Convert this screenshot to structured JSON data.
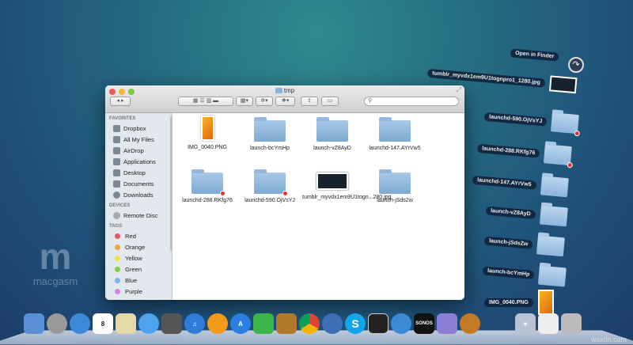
{
  "window": {
    "title": "tmp",
    "search_placeholder": ""
  },
  "sidebar": {
    "favorites_header": "FAVORITES",
    "favorites": [
      "Dropbox",
      "All My Files",
      "AirDrop",
      "Applications",
      "Desktop",
      "Documents",
      "Downloads"
    ],
    "devices_header": "DEVICES",
    "devices": [
      "Remote Disc"
    ],
    "tags_header": "TAGS",
    "tags": [
      {
        "label": "Red",
        "color": "#e8585a"
      },
      {
        "label": "Orange",
        "color": "#f4a43a"
      },
      {
        "label": "Yellow",
        "color": "#eee34a"
      },
      {
        "label": "Green",
        "color": "#8ccf42"
      },
      {
        "label": "Blue",
        "color": "#7ab4ec"
      },
      {
        "label": "Purple",
        "color": "#d183e6"
      }
    ]
  },
  "files": [
    {
      "name": "IMG_0040.PNG",
      "type": "png"
    },
    {
      "name": "launch-bcYmHp",
      "type": "folder"
    },
    {
      "name": "launch-vZ8AyD",
      "type": "folder"
    },
    {
      "name": "launchd-147.AYrVw5",
      "type": "folder"
    },
    {
      "name": "launchd-288.RKfg76",
      "type": "folder-locked"
    },
    {
      "name": "launchd-590.OjVsYJ",
      "type": "folder-locked"
    },
    {
      "name": "tumblr_myvdx1em9U1togn...280.jpg",
      "type": "jpg"
    },
    {
      "name": "launch-jSds2w",
      "type": "folder"
    }
  ],
  "stack": {
    "open_in_finder": "Open in Finder",
    "items": [
      "tumblr_myvdx1em9U1tognpro1_1280.jpg",
      "launchd-590.OjVsYJ",
      "launchd-288.RKfg76",
      "launchd-147.AYrVw5",
      "launch-vZ8AyD",
      "launch-jSdsZw",
      "launch-bcYmHp",
      "IMG_0040.PNG"
    ]
  },
  "dock": [
    "Finder",
    "Launchpad",
    "Safari",
    "Calendar",
    "Preview",
    "Messages",
    "FaceTime",
    "iTunes",
    "iBooks",
    "App Store",
    "Evernote",
    "Preview Viewer",
    "Chrome",
    "Tweetbot",
    "Skype",
    "Terminal",
    "TextExpander",
    "SONOS",
    "Transmit",
    "Coffee",
    "Downloads",
    "Document",
    "Trash"
  ],
  "dock_labels": {
    "calendar": "8",
    "sonos": "SONOS",
    "skype": "S"
  },
  "watermark": {
    "logo": "macgasm",
    "site": "wsxdn.com"
  }
}
